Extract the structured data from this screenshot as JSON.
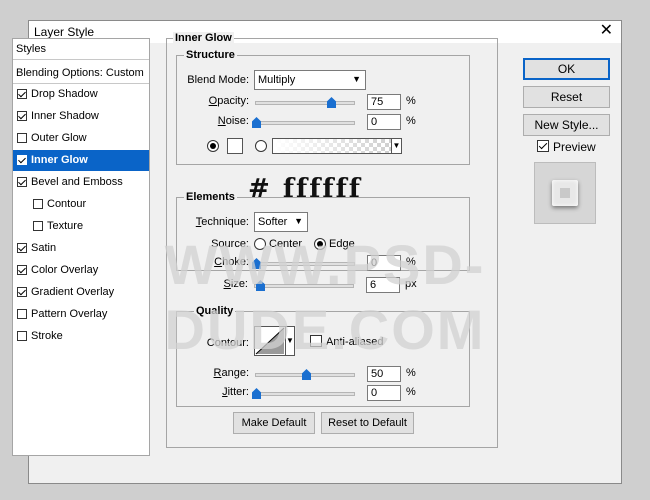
{
  "window": {
    "title": "Layer Style",
    "close_icon": "✕"
  },
  "sidebar": {
    "header": "Styles",
    "blending": "Blending Options: Custom",
    "items": [
      {
        "label": "Drop Shadow",
        "checked": true,
        "indent": false
      },
      {
        "label": "Inner Shadow",
        "checked": true,
        "indent": false
      },
      {
        "label": "Outer Glow",
        "checked": false,
        "indent": false
      },
      {
        "label": "Inner Glow",
        "checked": true,
        "indent": false,
        "selected": true
      },
      {
        "label": "Bevel and Emboss",
        "checked": true,
        "indent": false
      },
      {
        "label": "Contour",
        "checked": false,
        "indent": true
      },
      {
        "label": "Texture",
        "checked": false,
        "indent": true
      },
      {
        "label": "Satin",
        "checked": true,
        "indent": false
      },
      {
        "label": "Color Overlay",
        "checked": true,
        "indent": false
      },
      {
        "label": "Gradient Overlay",
        "checked": true,
        "indent": false
      },
      {
        "label": "Pattern Overlay",
        "checked": false,
        "indent": false
      },
      {
        "label": "Stroke",
        "checked": false,
        "indent": false
      }
    ]
  },
  "panel": {
    "title": "Inner Glow",
    "structure": {
      "title": "Structure",
      "blend_mode_label": "Blend Mode:",
      "blend_mode": "Multiply",
      "opacity_label": "Opacity:",
      "opacity": "75",
      "noise_label": "Noise:",
      "noise": "0",
      "percent": "%",
      "color_radio_selected": true,
      "gradient_radio_selected": false
    },
    "elements": {
      "title": "Elements",
      "technique_label": "Technique:",
      "technique": "Softer",
      "source_label": "Source:",
      "source_center": "Center",
      "source_edge": "Edge",
      "choke_label": "Choke:",
      "choke": "0",
      "size_label": "Size:",
      "size": "6",
      "percent": "%",
      "px": "px"
    },
    "quality": {
      "title": "Quality",
      "contour_label": "Contour:",
      "anti_aliased": "Anti-aliased",
      "anti_aliased_checked": false,
      "range_label": "Range:",
      "range": "50",
      "jitter_label": "Jitter:",
      "jitter": "0",
      "percent": "%"
    },
    "make_default": "Make Default",
    "reset_default": "Reset to Default"
  },
  "right": {
    "ok": "OK",
    "reset": "Reset",
    "new_style": "New Style...",
    "preview": "Preview",
    "preview_checked": true
  },
  "overlay": {
    "hex_color": "# ffffff",
    "watermark": "WWW.PSD-DUDE.COM"
  },
  "colors": {
    "accent": "#0a64c8",
    "slider_thumb": "#1a6fd0",
    "glow_color": "#ffffff"
  }
}
